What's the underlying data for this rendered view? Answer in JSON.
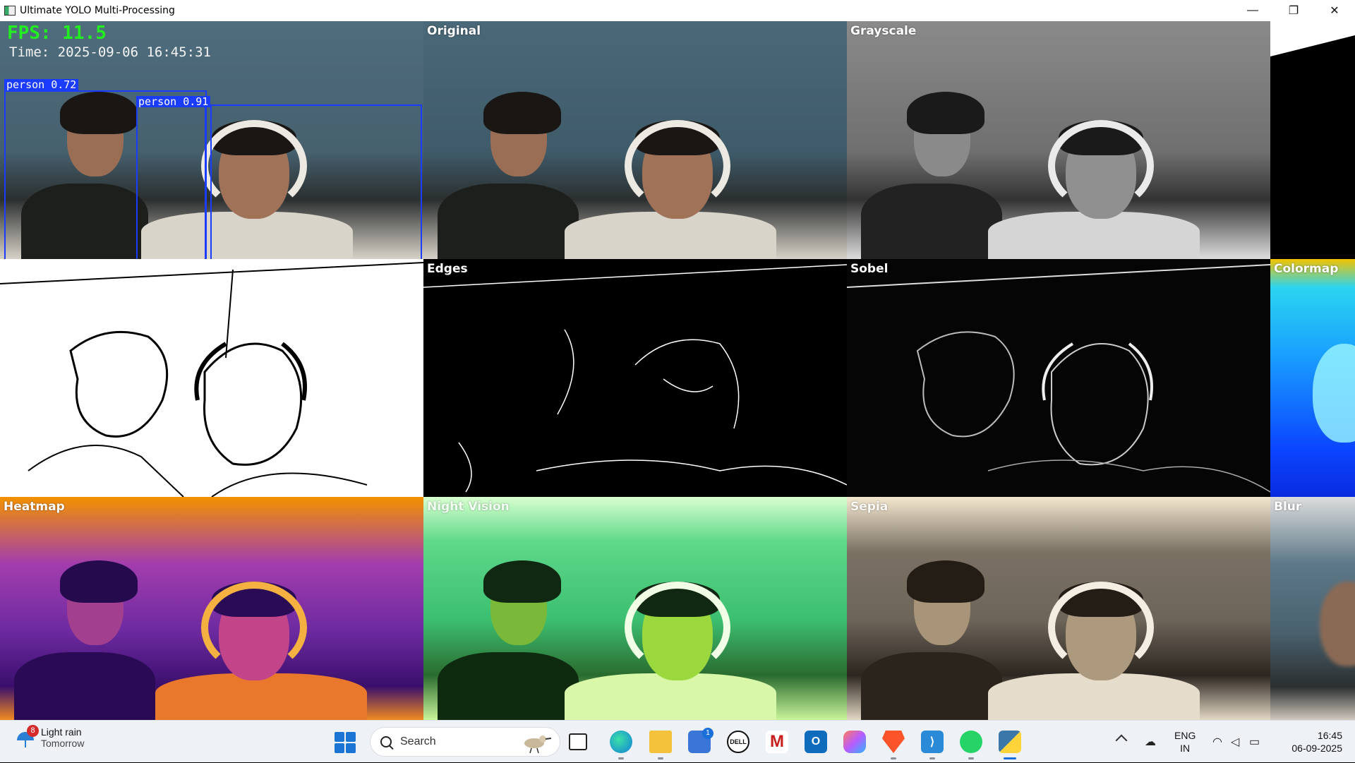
{
  "window": {
    "title": "Ultimate YOLO Multi-Processing",
    "controls": {
      "minimize": "—",
      "maximize": "❐",
      "close": "✕"
    }
  },
  "overlay": {
    "fps": "FPS: 11.5",
    "time": "Time: 2025-09-06 16:45:31",
    "detections": [
      {
        "label": "person 0.72"
      },
      {
        "label": "person 0.91"
      }
    ],
    "bbox_color": "#1a3cff",
    "fps_color": "#22ee22"
  },
  "tiles": {
    "original": "Original",
    "grayscale": "Grayscale",
    "edges": "Edges",
    "sobel": "Sobel",
    "colormap": "Colormap",
    "heatmap": "Heatmap",
    "night_vision": "Night Vision",
    "sepia": "Sepia",
    "blur": "Blur"
  },
  "taskbar": {
    "weather": {
      "badge": "8",
      "condition": "Light rain",
      "when": "Tomorrow"
    },
    "search_placeholder": "Search",
    "store_badge": "1",
    "apps": [
      {
        "name": "task-view-icon"
      },
      {
        "name": "edge-browser-icon"
      },
      {
        "name": "file-explorer-icon"
      },
      {
        "name": "microsoft-store-icon"
      },
      {
        "name": "dell-icon"
      },
      {
        "name": "mcafee-icon"
      },
      {
        "name": "outlook-icon"
      },
      {
        "name": "copilot-icon"
      },
      {
        "name": "brave-browser-icon"
      },
      {
        "name": "vscode-icon"
      },
      {
        "name": "whatsapp-icon"
      },
      {
        "name": "python-app-icon"
      }
    ],
    "lang_top": "ENG",
    "lang_bottom": "IN",
    "time": "16:45",
    "date": "06-09-2025"
  }
}
